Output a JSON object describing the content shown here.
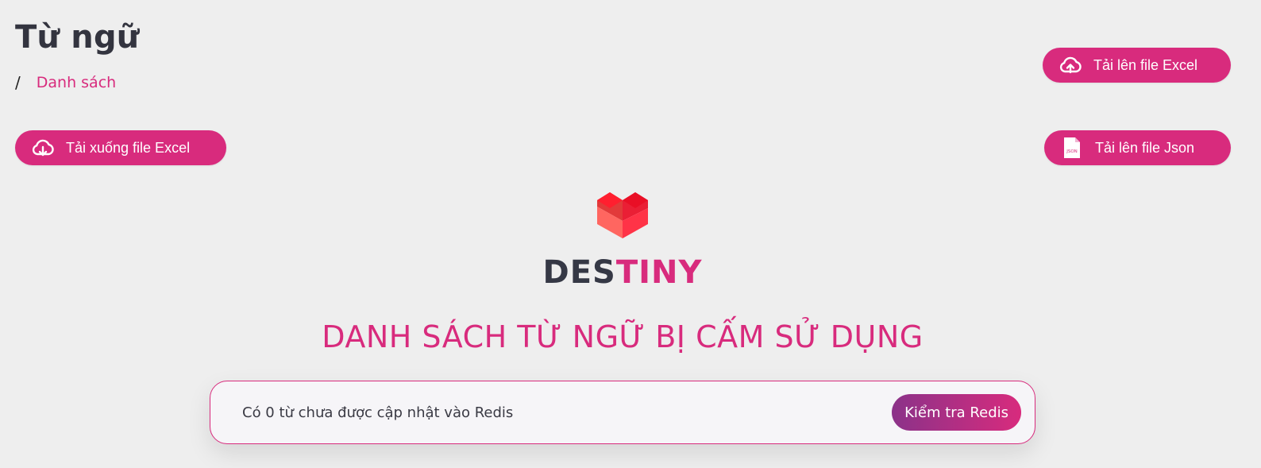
{
  "header": {
    "title": "Từ ngữ",
    "breadcrumb_separator": "/",
    "breadcrumb_current": "Danh sách"
  },
  "actions": {
    "upload_excel_label": "Tải lên file Excel",
    "download_excel_label": "Tải xuống file Excel",
    "upload_json_label": "Tải lên file Json",
    "json_icon_text": "JSON"
  },
  "branding": {
    "brand_part1": "DES",
    "brand_part2": "TINY",
    "logo_icon": "heart-cube-icon"
  },
  "main": {
    "headline": "DANH SÁCH TỪ NGỮ BỊ CẤM SỬ DỤNG",
    "notice_text": "Có 0 từ chưa được cập nhật vào Redis",
    "check_redis_label": "Kiểm tra Redis"
  },
  "colors": {
    "accent": "#d82b7d",
    "accent_gradient_start": "#8b3289",
    "background": "#eeeeee",
    "text_dark": "#33343f"
  }
}
